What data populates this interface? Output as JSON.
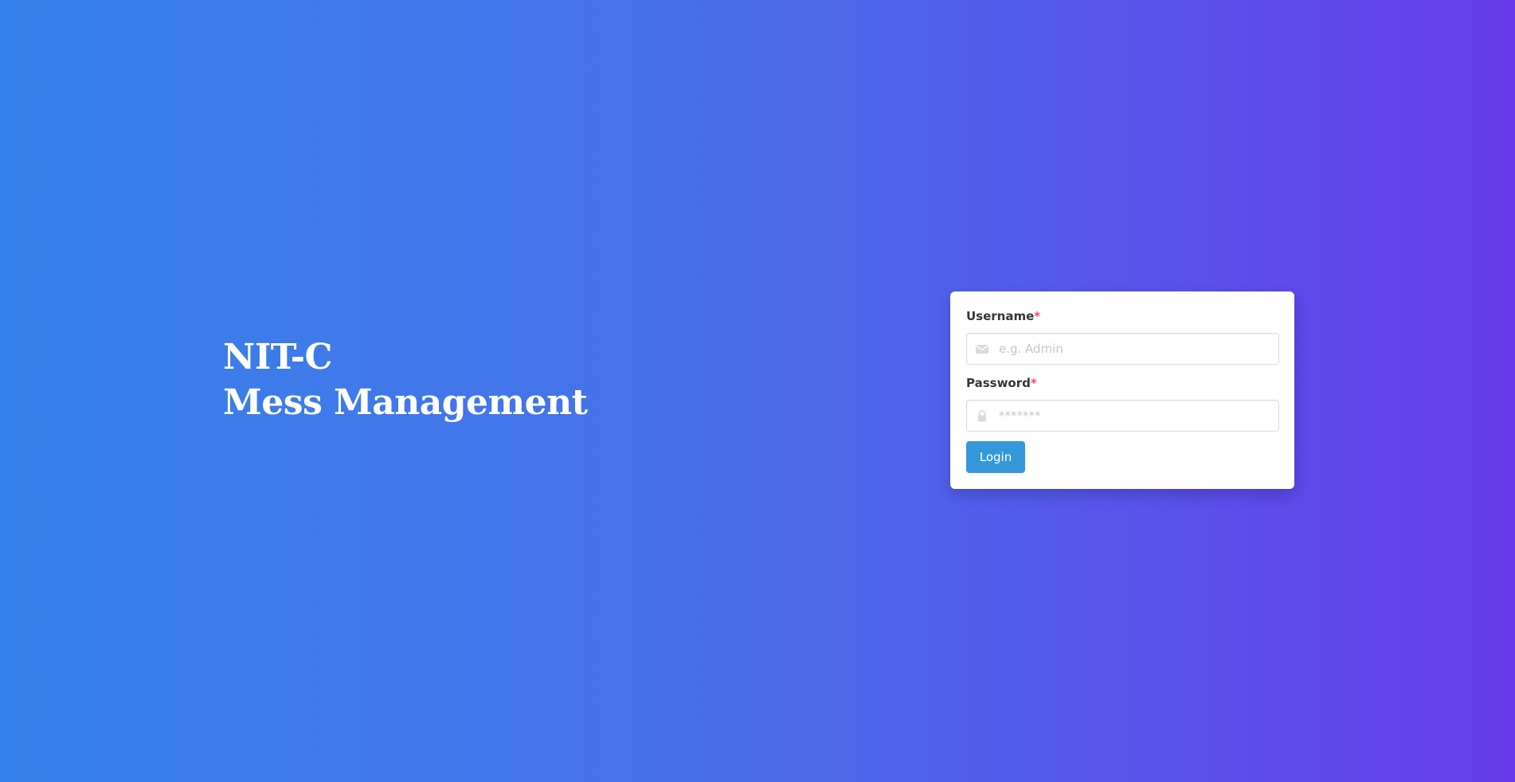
{
  "hero": {
    "line1": "NIT-C",
    "line2": "Mess Management"
  },
  "login_form": {
    "username": {
      "label": "Username",
      "required_marker": "*",
      "placeholder": "e.g. Admin",
      "value": "",
      "icon": "envelope-icon"
    },
    "password": {
      "label": "Password",
      "required_marker": "*",
      "placeholder": "*******",
      "value": "",
      "icon": "lock-icon"
    },
    "submit_label": "Login"
  },
  "colors": {
    "gradient_start": "#3580e8",
    "gradient_end": "#663cea",
    "button": "#3498db",
    "required": "#f14668",
    "card": "#ffffff"
  }
}
